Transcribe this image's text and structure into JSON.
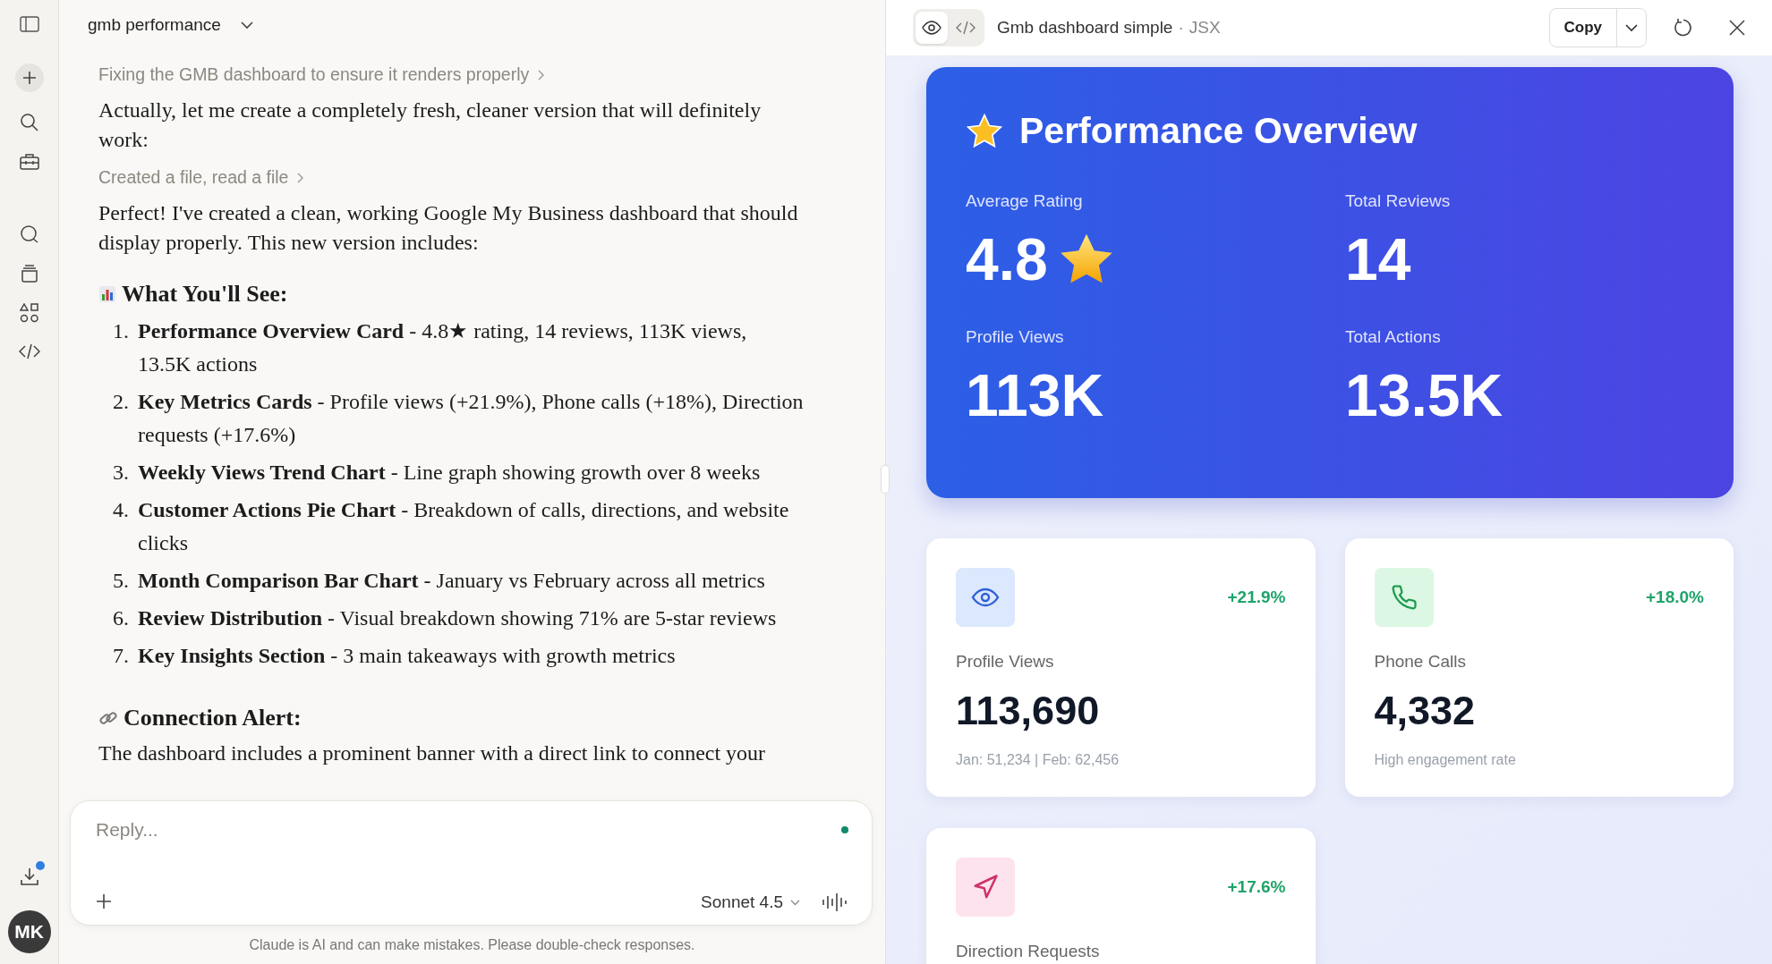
{
  "sidebar": {
    "avatar": "MK",
    "download_notification": true
  },
  "conversation": {
    "title": "gmb performance"
  },
  "messages": [
    {
      "kind": "step",
      "text": "Fixing the GMB dashboard to ensure it renders properly"
    },
    {
      "kind": "paragraph",
      "text": "Actually, let me create a completely fresh, cleaner version that will definitely work:"
    },
    {
      "kind": "step",
      "text": "Created a file, read a file"
    },
    {
      "kind": "paragraph",
      "text": "Perfect! I've created a clean, working Google My Business dashboard that should display properly. This new version includes:"
    },
    {
      "kind": "heading",
      "text": "What You'll See:"
    },
    {
      "kind": "list",
      "items": [
        {
          "number": "1.",
          "text": "**Performance Overview Card** - 4.8★ rating, 14 reviews, 113K views, 13.5K actions"
        },
        {
          "number": "2.",
          "text": "**Key Metrics Cards** - Profile views (+21.9%), Phone calls (+18%), Direction requests (+17.6%)"
        },
        {
          "number": "3.",
          "text": "**Weekly Views Trend Chart** - Line graph showing growth over 8 weeks"
        },
        {
          "number": "4.",
          "text": "**Customer Actions Pie Chart** - Breakdown of calls, directions, and website clicks"
        },
        {
          "number": "5.",
          "text": "**Month Comparison Bar Chart** - January vs February across all metrics"
        },
        {
          "number": "6.",
          "text": "**Review Distribution** - Visual breakdown showing 71% are 5-star reviews"
        },
        {
          "number": "7.",
          "text": "**Key Insights Section** - 3 main takeaways with growth metrics"
        }
      ]
    },
    {
      "kind": "heading",
      "text": "Connection Alert:"
    },
    {
      "kind": "paragraph",
      "text": "The dashboard includes a prominent banner with a direct link to connect your"
    }
  ],
  "composer": {
    "placeholder": "Reply...",
    "model": "Sonnet 4.5",
    "disclaimer": "Claude is AI and can make mistakes. Please double-check responses."
  },
  "artifact": {
    "title": "Gmb dashboard simple",
    "separator": "·",
    "type": "JSX",
    "copy_label": "Copy",
    "view_tabs": [
      {
        "kind": "preview",
        "selected": true
      },
      {
        "kind": "code",
        "selected": false
      }
    ],
    "overview": {
      "title": "Performance Overview",
      "stats": [
        {
          "kind": "rating",
          "label": "Average Rating",
          "value": "4.8"
        },
        {
          "kind": "plain",
          "label": "Total Reviews",
          "value": "14"
        },
        {
          "kind": "plain",
          "label": "Profile Views",
          "value": "113K"
        },
        {
          "kind": "plain",
          "label": "Total Actions",
          "value": "13.5K"
        }
      ]
    },
    "metrics": [
      {
        "kind": "views",
        "color": "#2f5fd8",
        "change": "+21.9%",
        "label": "Profile Views",
        "value": "113,690",
        "note": "Jan: 51,234 | Feb: 62,456"
      },
      {
        "kind": "calls",
        "color": "#1f9a4e",
        "change": "+18.0%",
        "label": "Phone Calls",
        "value": "4,332",
        "note": "High engagement rate"
      },
      {
        "kind": "directions",
        "color": "#d0306a",
        "change": "+17.6%",
        "label": "Direction Requests"
      }
    ]
  }
}
